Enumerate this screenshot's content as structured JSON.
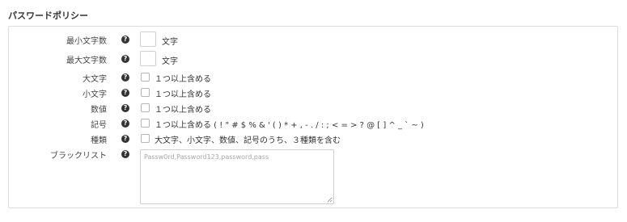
{
  "section": {
    "title": "パスワードポリシー"
  },
  "help_glyph": "?",
  "fields": {
    "min_length": {
      "label": "最小文字数",
      "value": "",
      "unit": "文字"
    },
    "max_length": {
      "label": "最大文字数",
      "value": "",
      "unit": "文字"
    }
  },
  "rules": [
    {
      "label": "大文字",
      "text": "１つ以上含める",
      "checked": false
    },
    {
      "label": "小文字",
      "text": "１つ以上含める",
      "checked": false
    },
    {
      "label": "数値",
      "text": "１つ以上含める",
      "checked": false
    },
    {
      "label": "記号",
      "text": "１つ以上含める ( ! \" # $ % & ' ( ) * + , - . / : ; < = > ? @ [ ] ^ _ ` ~ )",
      "checked": false
    },
    {
      "label": "種類",
      "text": "大文字、小文字、数値、記号のうち、３種類を含む",
      "checked": false
    }
  ],
  "blacklist": {
    "label": "ブラックリスト",
    "value": "",
    "placeholder": "Passw0rd,Password123,password,pass"
  }
}
